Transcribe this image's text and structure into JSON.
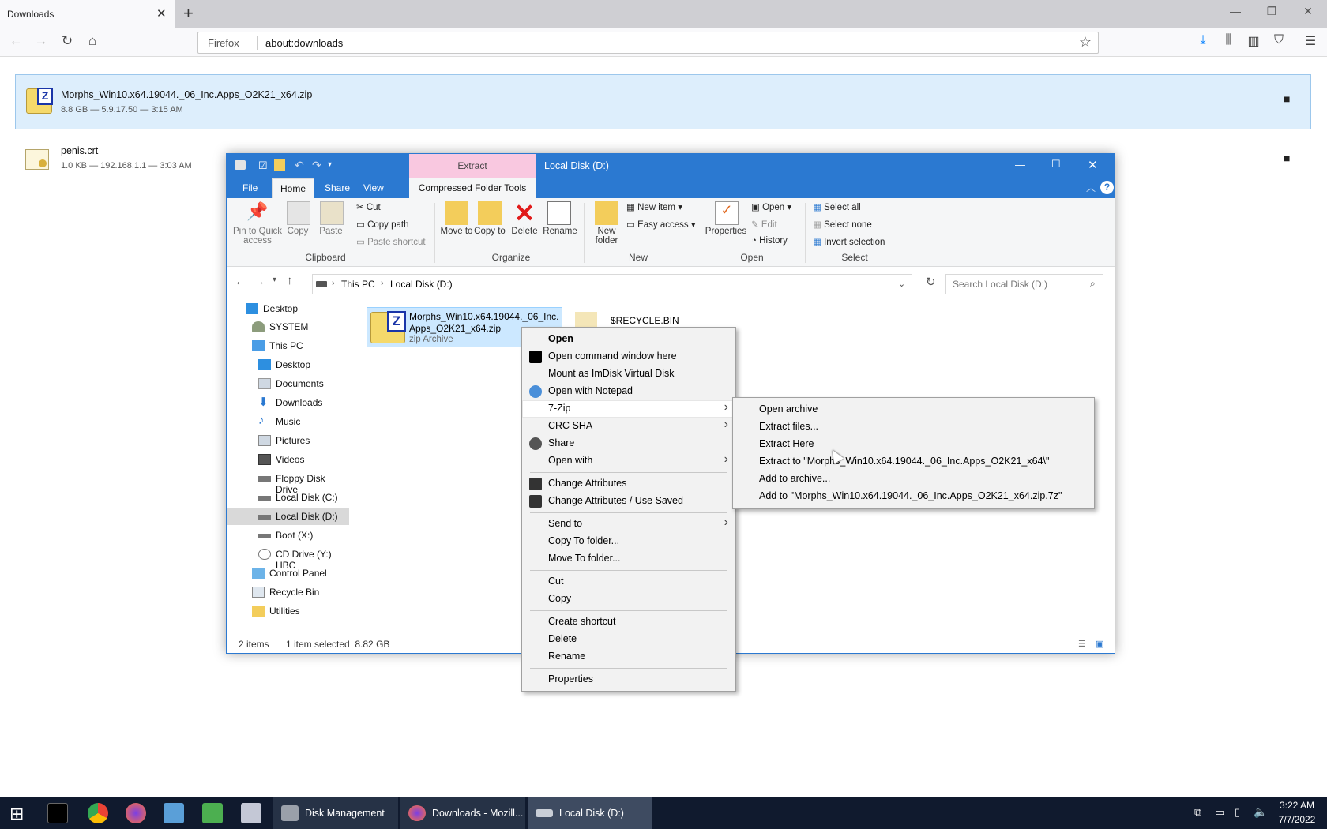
{
  "browser": {
    "tab_title": "Downloads",
    "tab_close": "✕",
    "new_tab": "+",
    "identity": "Firefox",
    "url": "about:downloads"
  },
  "downloads": [
    {
      "name": "Morphs_Win10.x64.19044._06_Inc.Apps_O2K21_x64.zip",
      "meta": "8.8 GB — 5.9.17.50 — 3:15 AM"
    },
    {
      "name": "penis.crt",
      "meta": "1.0 KB — 192.168.1.1 — 3:03 AM"
    }
  ],
  "explorer": {
    "title": "Local Disk (D:)",
    "context_tab": "Extract",
    "tabs": [
      "File",
      "Home",
      "Share",
      "View",
      "Compressed Folder Tools"
    ],
    "ribbon": {
      "pin": "Pin to Quick access",
      "copy": "Copy",
      "paste": "Paste",
      "cut": "Cut",
      "copy_path": "Copy path",
      "paste_shortcut": "Paste shortcut",
      "clipboard": "Clipboard",
      "move_to": "Move to",
      "copy_to": "Copy to",
      "delete": "Delete",
      "rename": "Rename",
      "organize": "Organize",
      "new_folder": "New folder",
      "new_item": "New item",
      "easy_access": "Easy access",
      "new": "New",
      "properties": "Properties",
      "open": "Open",
      "edit": "Edit",
      "history": "History",
      "open_group": "Open",
      "select_all": "Select all",
      "select_none": "Select none",
      "invert_selection": "Invert selection",
      "select_group": "Select"
    },
    "breadcrumb": [
      "This PC",
      "Local Disk (D:)"
    ],
    "search_placeholder": "Search Local Disk (D:)",
    "tree": [
      {
        "label": "Desktop",
        "icon": "desktop-icon",
        "indent": 0
      },
      {
        "label": "SYSTEM",
        "icon": "user-icon",
        "indent": 1
      },
      {
        "label": "This PC",
        "icon": "pc-icon",
        "indent": 1
      },
      {
        "label": "Desktop",
        "icon": "desktop-icon",
        "indent": 2
      },
      {
        "label": "Documents",
        "icon": "documents-icon",
        "indent": 2
      },
      {
        "label": "Downloads",
        "icon": "downloads-icon",
        "indent": 2
      },
      {
        "label": "Music",
        "icon": "music-icon",
        "indent": 2
      },
      {
        "label": "Pictures",
        "icon": "pictures-icon",
        "indent": 2
      },
      {
        "label": "Videos",
        "icon": "videos-icon",
        "indent": 2
      },
      {
        "label": "Floppy Disk Drive",
        "icon": "floppy-icon",
        "indent": 2
      },
      {
        "label": "Local Disk (C:)",
        "icon": "drive-icon",
        "indent": 2
      },
      {
        "label": "Local Disk (D:)",
        "icon": "drive-icon",
        "indent": 2,
        "selected": true
      },
      {
        "label": "Boot (X:)",
        "icon": "drive-icon",
        "indent": 2
      },
      {
        "label": "CD Drive (Y:) HBC",
        "icon": "cd-drive-icon",
        "indent": 2
      },
      {
        "label": "Control Panel",
        "icon": "control-panel-icon",
        "indent": 1
      },
      {
        "label": "Recycle Bin",
        "icon": "recycle-bin-icon",
        "indent": 1
      },
      {
        "label": "Utilities",
        "icon": "folder-icon",
        "indent": 1
      }
    ],
    "files": [
      {
        "name": "Morphs_Win10.x64.19044._06_Inc.Apps_O2K21_x64.zip",
        "type": "zip Archive"
      },
      {
        "name": "$RECYCLE.BIN"
      }
    ],
    "status": {
      "items": "2 items",
      "selected": "1 item selected  8.82 GB"
    }
  },
  "context_menu": [
    {
      "label": "Open",
      "bold": true
    },
    {
      "label": "Open command window here",
      "icon": "cmd-icon"
    },
    {
      "label": "Mount as ImDisk Virtual Disk"
    },
    {
      "label": "Open with Notepad",
      "icon": "notepad-icon"
    },
    {
      "label": "7-Zip",
      "submenu": true,
      "highlight": true
    },
    {
      "label": "CRC SHA",
      "submenu": true
    },
    {
      "label": "Share",
      "icon": "share-icon"
    },
    {
      "label": "Open with",
      "submenu": true
    },
    {
      "sep": true
    },
    {
      "label": "Change Attributes",
      "icon": "attributes-icon"
    },
    {
      "label": "Change Attributes / Use Saved",
      "icon": "attributes-icon"
    },
    {
      "sep": true
    },
    {
      "label": "Send to",
      "submenu": true
    },
    {
      "label": "Copy To folder..."
    },
    {
      "label": "Move To folder..."
    },
    {
      "sep": true
    },
    {
      "label": "Cut"
    },
    {
      "label": "Copy"
    },
    {
      "sep": true
    },
    {
      "label": "Create shortcut"
    },
    {
      "label": "Delete"
    },
    {
      "label": "Rename"
    },
    {
      "sep": true
    },
    {
      "label": "Properties"
    }
  ],
  "submenu_7zip": [
    "Open archive",
    "Extract files...",
    "Extract Here",
    "Extract to \"Morphs_Win10.x64.19044._06_Inc.Apps_O2K21_x64\\\"",
    "Add to archive...",
    "Add to \"Morphs_Win10.x64.19044._06_Inc.Apps_O2K21_x64.zip.7z\""
  ],
  "taskbar": {
    "tasks": [
      "Disk Management",
      "Downloads - Mozill...",
      "Local Disk (D:)"
    ],
    "time": "3:22 AM",
    "date": "7/7/2022"
  },
  "colors": {
    "accent": "#2b79d1",
    "selection": "#cce8ff",
    "taskbar": "#101a2e"
  }
}
